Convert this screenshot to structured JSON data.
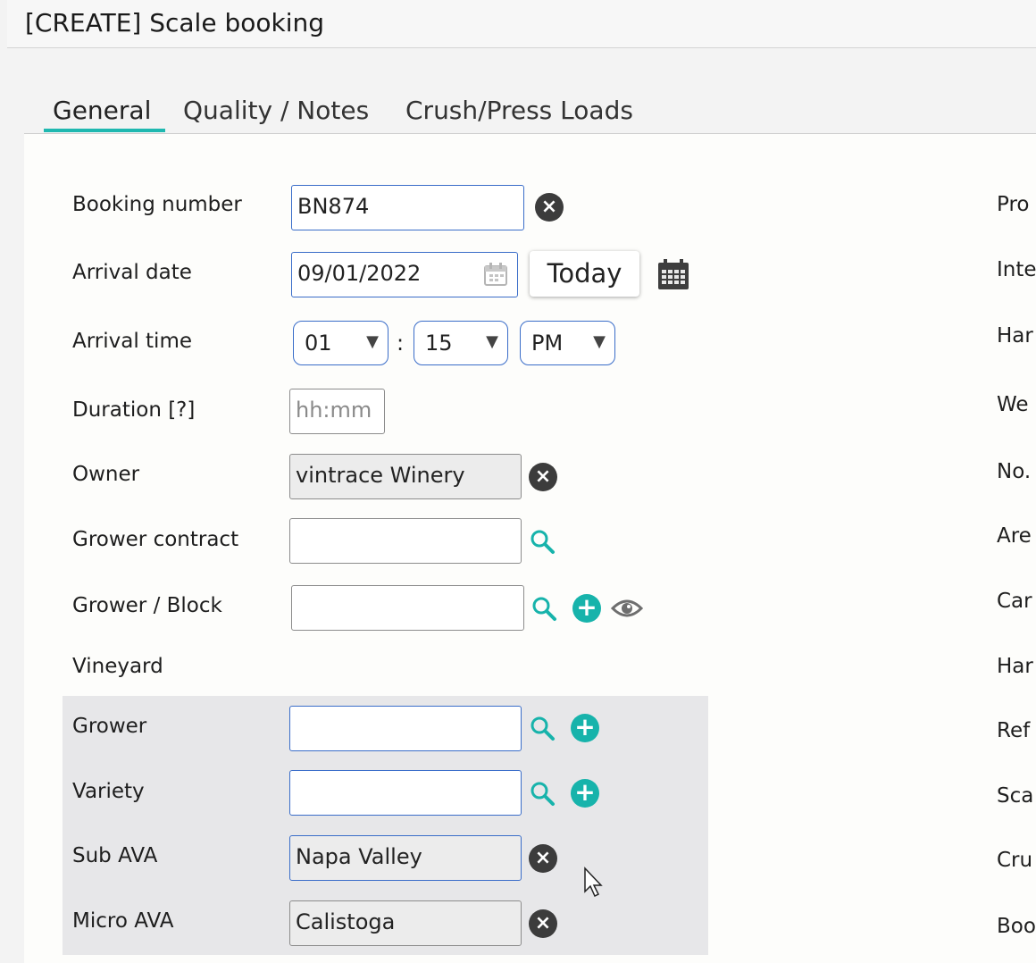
{
  "window": {
    "title": "[CREATE] Scale booking"
  },
  "tabs": [
    {
      "label": "General"
    },
    {
      "label": "Quality / Notes"
    },
    {
      "label": "Crush/Press Loads"
    }
  ],
  "form": {
    "booking_number": {
      "label": "Booking number",
      "value": "BN874"
    },
    "arrival_date": {
      "label": "Arrival date",
      "value": "09/01/2022",
      "today_label": "Today"
    },
    "arrival_time": {
      "label": "Arrival time",
      "hour": "01",
      "minute": "15",
      "ampm": "PM",
      "separator": ":"
    },
    "duration": {
      "label": "Duration [?]",
      "placeholder": "hh:mm"
    },
    "owner": {
      "label": "Owner",
      "value": "vintrace Winery"
    },
    "grower_contract": {
      "label": "Grower contract",
      "value": ""
    },
    "grower_block": {
      "label": "Grower / Block",
      "value": ""
    },
    "vineyard": {
      "label": "Vineyard",
      "grower": {
        "label": "Grower",
        "value": ""
      },
      "variety": {
        "label": "Variety",
        "value": ""
      },
      "sub_ava": {
        "label": "Sub AVA",
        "value": "Napa Valley"
      },
      "micro_ava": {
        "label": "Micro AVA",
        "value": "Calistoga"
      }
    }
  },
  "right_labels": [
    "Pro",
    "Inte",
    "Har",
    "We",
    "No.",
    "Are",
    "Car",
    "Har",
    "Ref",
    "Sca",
    "Cru",
    "Boo"
  ],
  "colors": {
    "accent": "#1fb8b0",
    "focus_border": "#3a6dc9",
    "clear_icon": "#3c3c3c",
    "add_icon": "#17b3ab"
  }
}
